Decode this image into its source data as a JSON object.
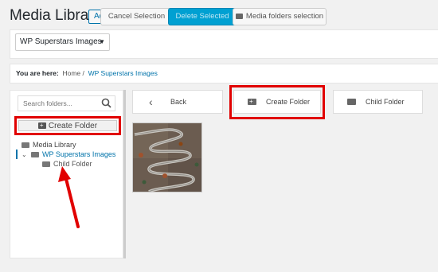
{
  "header": {
    "title": "Media Library",
    "add_new": "Add New"
  },
  "toolbar": {
    "folder_select": "WP Superstars Images",
    "cancel_selection": "Cancel Selection",
    "delete_selected": "Delete Selected",
    "media_folders_selection": "Media folders selection"
  },
  "breadcrumb": {
    "prefix": "You are here",
    "separator": ":",
    "home": "Home",
    "divider": "/",
    "current": "WP Superstars Images"
  },
  "sidebar": {
    "search_placeholder": "Search folders...",
    "create_folder": "Create Folder",
    "tree": [
      {
        "label": "Media Library"
      },
      {
        "label": "WP Superstars Images",
        "expanded": true,
        "selected": true
      },
      {
        "label": "Child Folder"
      }
    ]
  },
  "main": {
    "back": "Back",
    "create_folder": "Create Folder",
    "child_folder": "Child Folder"
  },
  "colors": {
    "accent": "#0073aa",
    "highlight": "#e10000",
    "delete_button": "#00a0d2"
  }
}
